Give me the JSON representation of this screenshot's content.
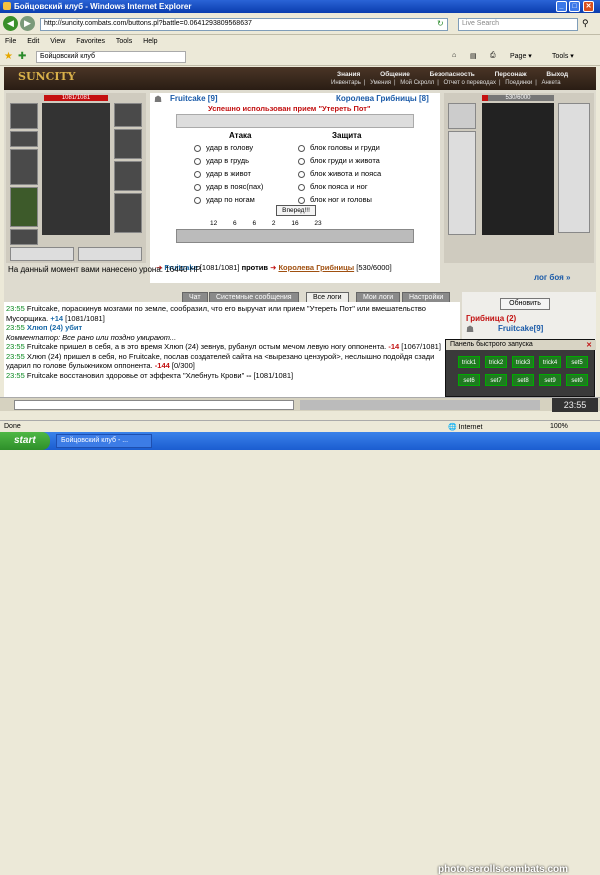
{
  "window": {
    "title": "Бойцовский клуб - Windows Internet Explorer"
  },
  "browser": {
    "url": "http://suncity.combats.com/buttons.pl?battle=0.0641293809568637",
    "search_placeholder": "Live Search",
    "menu": [
      "File",
      "Edit",
      "View",
      "Favorites",
      "Tools",
      "Help"
    ],
    "tab_title": "Бойцовский клуб",
    "page_label": "Page",
    "tools_label": "Tools"
  },
  "game": {
    "logo": "SUNCITY",
    "topnav": [
      "Знания",
      "Общение",
      "Безопасность",
      "Персонаж",
      "Выход"
    ],
    "subnav": [
      "Инвентарь",
      "Умения",
      "Мой Скролл",
      "Отчет о переводах",
      "Поединки",
      "Анкета"
    ],
    "player": {
      "name": "Fruitcake [9]",
      "hp": "1081/1081",
      "hp_ratio": 1.0
    },
    "opponent": {
      "name": "Королева Грибницы [8]",
      "hp": "530/6000",
      "hp_ratio": 0.088
    },
    "combat_msg": "Успешно использован прием \"Утереть Пот\"",
    "attack_title": "Атака",
    "defense_title": "Защита",
    "attack_options": [
      "удар в голову",
      "удар в грудь",
      "удар в живот",
      "удар в пояс(пах)",
      "удар по ногам"
    ],
    "defense_options": [
      "блок головы и груди",
      "блок груди и живота",
      "блок живота и пояса",
      "блок пояса и ног",
      "блок ног и головы"
    ],
    "hit_button": "Вперед!!!",
    "counters": [
      "12",
      "6",
      "6",
      "2",
      "16",
      "23"
    ],
    "versus": {
      "player": "Fruitcake",
      "player_hp": "[1081/1081]",
      "vs": "против",
      "opponent": "Королева Грибницы",
      "opponent_hp": "[530/6000]"
    },
    "damage_line": "На данный момент вами нанесено урона: 16440 HP.",
    "log_link": "лог боя »",
    "tabs": [
      "Чат",
      "Системные сообщения",
      "Все логи",
      "Мои логи",
      "Настройки"
    ],
    "refresh_button": "Обновить",
    "team_label": "Грибница (2)",
    "team_member": "Fruitcake[9]",
    "quick_panel": {
      "title": "Панель быстрого запуска",
      "buttons": [
        "trick1",
        "trick2",
        "trick3",
        "trick4",
        "set5",
        "set6",
        "set7",
        "set8",
        "set9",
        "set0"
      ]
    },
    "clock": "23:55"
  },
  "chat": [
    {
      "time": "23:55",
      "text": "Fruitcake, пораскинув мозгами по земле, сообразил, что его выручат или прием \"Утереть Пот\" или вмешательство Мусорщика.",
      "val": "+14",
      "tail": "[1081/1081]"
    },
    {
      "time": "23:55",
      "text": "Хлюп (24) убит",
      "val": "",
      "tail": ""
    },
    {
      "time": "",
      "text": "Комментатор: Все рано или поздно умирают...",
      "val": "",
      "tail": ""
    },
    {
      "time": "23:55",
      "text": "Fruitcake пришел в себя, а в это время Хлюп (24) зевнув, рубанул остым мечом левую ногу оппонента.",
      "val": "-14",
      "tail": "[1067/1081]"
    },
    {
      "time": "23:55",
      "text": "Хлюп (24) пришел в себя, но Fruitcake, послав создателей сайта на <вырезано цензурой>, неслышно подойдя сзади ударил по голове булыжником оппонента.",
      "val": "-144",
      "tail": "[0/300]"
    },
    {
      "time": "23:55",
      "text": "Fruitcake восстановил здоровье от эффекта \"Хлебнуть Крови\"",
      "val": "--",
      "tail": "[1081/1081]"
    }
  ],
  "status": {
    "left": "Done",
    "zone": "Internet",
    "zoom": "100%"
  },
  "taskbar": {
    "start": "start",
    "task": "Бойцовский клуб - ..."
  },
  "watermark": "photo.scrolls.combats.com"
}
